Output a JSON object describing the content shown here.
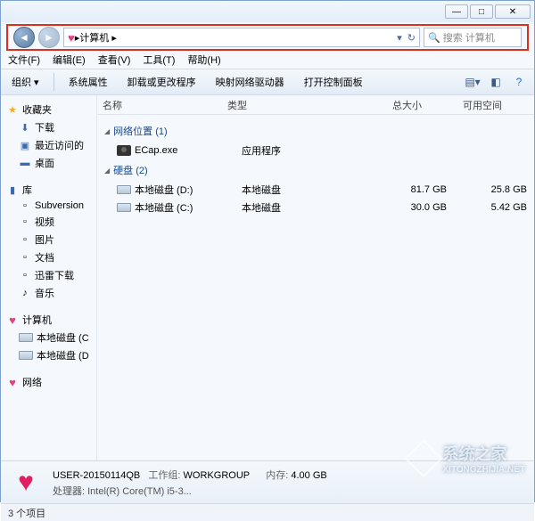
{
  "titlebar": {
    "min": "—",
    "max": "□",
    "close": "✕"
  },
  "nav": {
    "back": "◄",
    "fwd": "►",
    "path_root": "计算机",
    "sep": "▸",
    "refresh": "↻",
    "search_icon": "🔍",
    "search_placeholder": "搜索 计算机"
  },
  "menu": [
    "文件(F)",
    "编辑(E)",
    "查看(V)",
    "工具(T)",
    "帮助(H)"
  ],
  "toolbar": {
    "organize": "组织 ▾",
    "properties": "系统属性",
    "uninstall": "卸载或更改程序",
    "mapdrive": "映射网络驱动器",
    "controlpanel": "打开控制面板"
  },
  "sidebar": {
    "favorites": {
      "label": "收藏夹",
      "items": [
        "下载",
        "最近访问的",
        "桌面"
      ]
    },
    "libraries": {
      "label": "库",
      "items": [
        "Subversion",
        "视频",
        "图片",
        "文档",
        "迅雷下载",
        "音乐"
      ]
    },
    "computer": {
      "label": "计算机",
      "items": [
        "本地磁盘 (C",
        "本地磁盘 (D"
      ]
    },
    "network": {
      "label": "网络"
    }
  },
  "columns": {
    "name": "名称",
    "type": "类型",
    "size": "总大小",
    "free": "可用空间"
  },
  "groups": [
    {
      "title": "网络位置 (1)",
      "rows": [
        {
          "name": "ECap.exe",
          "type": "应用程序",
          "size": "",
          "free": "",
          "icon": "cam"
        }
      ]
    },
    {
      "title": "硬盘 (2)",
      "rows": [
        {
          "name": "本地磁盘 (D:)",
          "type": "本地磁盘",
          "size": "81.7 GB",
          "free": "25.8 GB",
          "icon": "drive"
        },
        {
          "name": "本地磁盘 (C:)",
          "type": "本地磁盘",
          "size": "30.0 GB",
          "free": "5.42 GB",
          "icon": "drive"
        }
      ]
    }
  ],
  "details": {
    "computer_name": "USER-20150114QB",
    "workgroup_label": "工作组:",
    "workgroup": "WORKGROUP",
    "mem_label": "内存:",
    "mem": "4.00 GB",
    "cpu_label": "处理器:",
    "cpu": "Intel(R) Core(TM) i5-3..."
  },
  "status": "3 个项目",
  "watermark": {
    "text": "系统之家",
    "url": "XITONGZHIJIA.NET"
  }
}
